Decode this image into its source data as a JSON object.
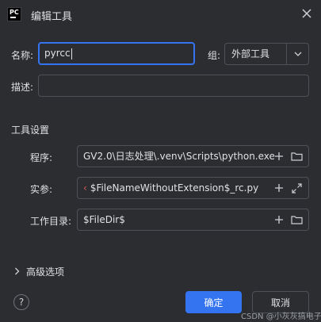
{
  "window": {
    "title": "编辑工具",
    "close_icon": "close-icon",
    "logo_text": "PC"
  },
  "form": {
    "name_label": "名称:",
    "name_value": "pyrcc",
    "group_label": "组:",
    "group_value": "外部工具",
    "description_label": "描述:",
    "description_value": ""
  },
  "tool_settings": {
    "section_title": "工具设置",
    "program_label": "程序:",
    "program_value": "GV2.0\\日志处理\\.venv\\Scripts\\python.exe",
    "arguments_label": "实参:",
    "arguments_value": "$FileNameWithoutExtension$_rc.py",
    "workdir_label": "工作目录:",
    "workdir_value": "$FileDir$"
  },
  "advanced": {
    "label": "高级选项"
  },
  "buttons": {
    "ok": "确定",
    "cancel": "取消",
    "help": "?"
  },
  "watermark": "CSDN @小灰灰搞电子",
  "colors": {
    "accent": "#3574f0",
    "background": "#2b2d30",
    "border": "#4e5157"
  }
}
